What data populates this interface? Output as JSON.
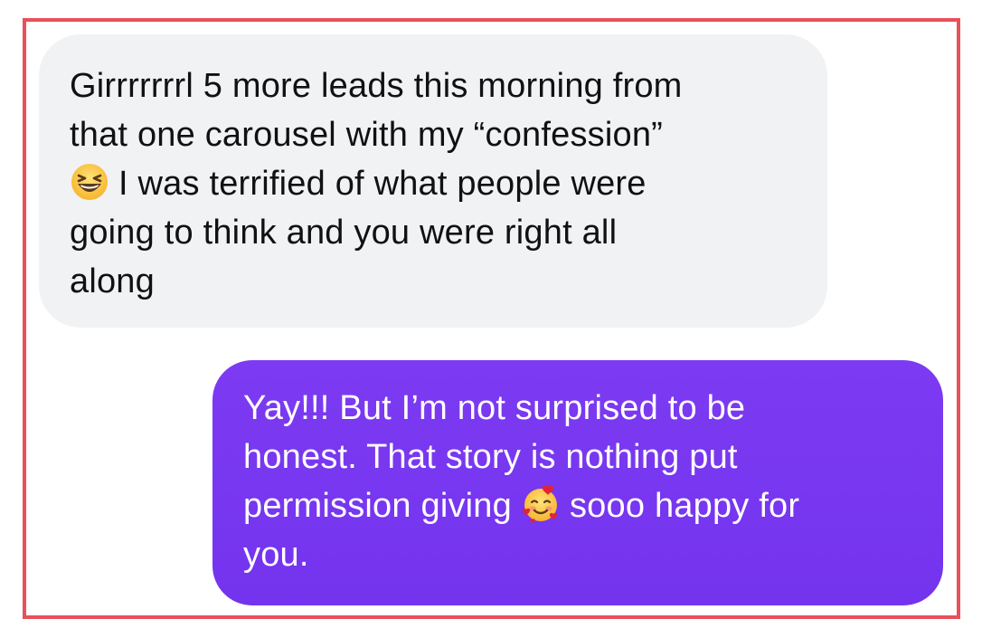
{
  "messages": {
    "incoming": {
      "line1": "Girrrrrrrl 5 more leads this morning from",
      "line2": "that one carousel with my “confession”",
      "line3_emoji": "grinning-squinting-face-icon",
      "line3_text": "I was terrified of what people were",
      "line4": "going to think and you were right all",
      "line5": "along"
    },
    "outgoing": {
      "line1": "Yay!!! But I’m not surprised to be",
      "line2": "honest. That story is nothing put",
      "line3_before": "permission giving",
      "line3_emoji": "smiling-face-with-hearts-icon",
      "line3_after": "sooo happy for",
      "line4": "you."
    }
  },
  "colors": {
    "frame_border": "#e8505b",
    "incoming_bubble": "#f1f2f4",
    "outgoing_bubble": "#7833f0",
    "outgoing_text": "#ffffff"
  }
}
